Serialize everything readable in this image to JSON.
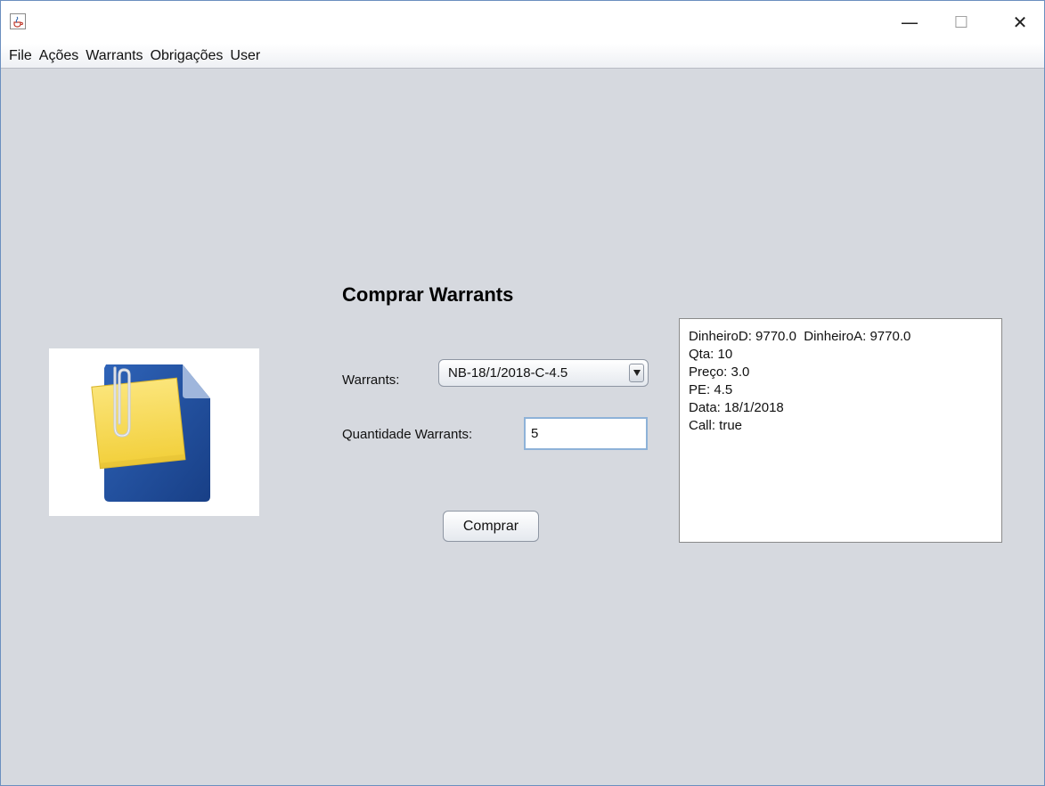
{
  "window": {
    "controls": {
      "minimize": "—",
      "maximize": "☐",
      "close": "✕"
    }
  },
  "menu": [
    "File",
    "Ações",
    "Warrants",
    "Obrigações",
    "User"
  ],
  "form": {
    "title": "Comprar Warrants",
    "warrants_label": "Warrants:",
    "warrants_selected": "NB-18/1/2018-C-4.5",
    "quantity_label": "Quantidade Warrants:",
    "quantity_value": "5",
    "buy_label": "Comprar"
  },
  "info": {
    "lines": [
      "DinheiroD: 9770.0  DinheiroA: 9770.0",
      "Qta: 10",
      "Preço: 3.0",
      "PE: 4.5",
      "Data: 18/1/2018",
      "Call: true"
    ]
  },
  "icons": {
    "app": "java-coffee-icon",
    "logo": "document-with-sticky-note-icon",
    "dropdown": "triangle-down-icon"
  },
  "colors": {
    "background": "#d6d9df",
    "window_border": "#6b8fbf",
    "document_blue": "#1f4f9c",
    "note_yellow": "#f7d84a"
  }
}
